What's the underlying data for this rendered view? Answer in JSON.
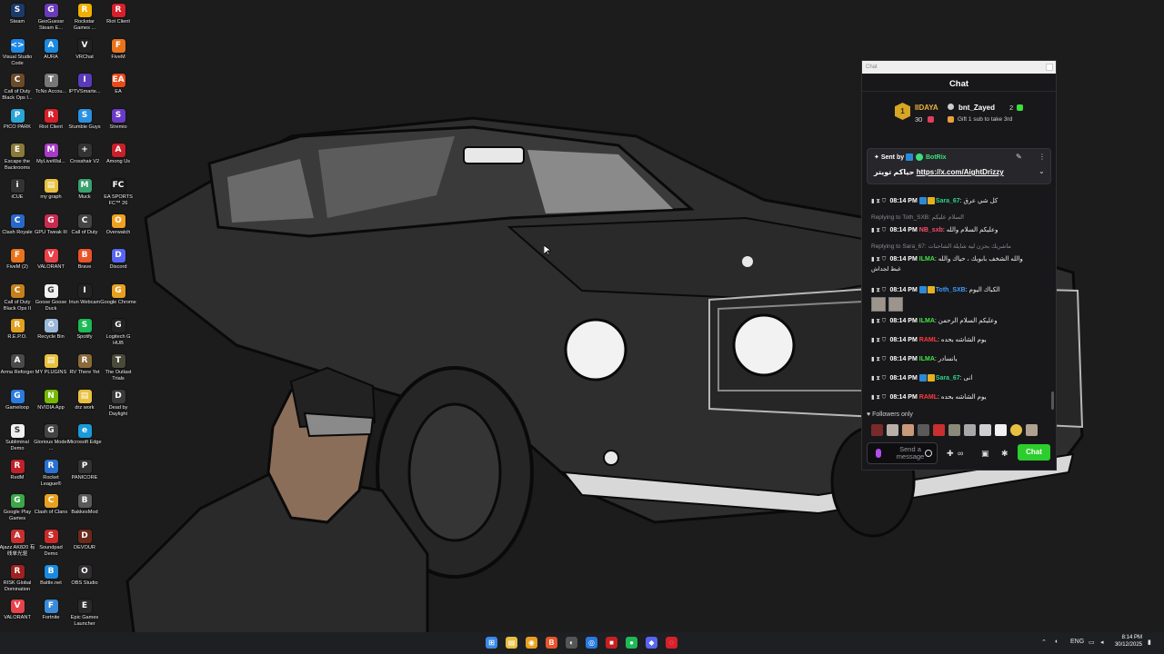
{
  "desktop_icons": [
    {
      "label": "Steam",
      "color": "#1a3a6b",
      "glyph": "S"
    },
    {
      "label": "Visual Studio Code",
      "color": "#1e88e5",
      "glyph": "<>"
    },
    {
      "label": "Call of Duty Black Ops I...",
      "color": "#6b4a2a",
      "glyph": "C"
    },
    {
      "label": "PICO PARK",
      "color": "#2aa5d8",
      "glyph": "P"
    },
    {
      "label": "Escape the Backrooms",
      "color": "#8a7a3a",
      "glyph": "E"
    },
    {
      "label": "iCUE",
      "color": "#333333",
      "glyph": "i"
    },
    {
      "label": "Clash Royale",
      "color": "#2a68c8",
      "glyph": "C"
    },
    {
      "label": "FiveM (2)",
      "color": "#e8731c",
      "glyph": "F"
    },
    {
      "label": "Call of Duty Black Ops II",
      "color": "#c4801a",
      "glyph": "C"
    },
    {
      "label": "R.E.P.O.",
      "color": "#e0a020",
      "glyph": "R"
    },
    {
      "label": "Arma Reforger",
      "color": "#4a4a4a",
      "glyph": "A"
    },
    {
      "label": "Gameloop",
      "color": "#2a7ae0",
      "glyph": "G"
    },
    {
      "label": "Subliminal Demo",
      "color": "#f0f0f0",
      "glyph": "S"
    },
    {
      "label": "RedM",
      "color": "#c0202a",
      "glyph": "R"
    },
    {
      "label": "Google Play Games",
      "color": "#3ca64a",
      "glyph": "G"
    },
    {
      "label": "Ajazz AK820 有线单光驱",
      "color": "#c83030",
      "glyph": "A"
    },
    {
      "label": "RISK Global Domination",
      "color": "#a02020",
      "glyph": "R"
    },
    {
      "label": "VALORANT",
      "color": "#e8424a",
      "glyph": "V"
    },
    {
      "label": "GeoGuessr Steam E...",
      "color": "#6a3ab8",
      "glyph": "G"
    },
    {
      "label": "AURA",
      "color": "#1a8ae0",
      "glyph": "A"
    },
    {
      "label": "TcNo Accou...",
      "color": "#777777",
      "glyph": "T"
    },
    {
      "label": "Riot Client",
      "color": "#d8202a",
      "glyph": "R"
    },
    {
      "label": "MyLiveWal...",
      "color": "#a83ac8",
      "glyph": "M"
    },
    {
      "label": "my graph",
      "color": "#e8c040",
      "glyph": "▤"
    },
    {
      "label": "GPU Tweak III",
      "color": "#c82a50",
      "glyph": "G"
    },
    {
      "label": "VALORANT",
      "color": "#e8424a",
      "glyph": "V"
    },
    {
      "label": "Goose Goose Duck",
      "color": "#f0f0f0",
      "glyph": "G"
    },
    {
      "label": "Recycle Bin",
      "color": "#9ab8d8",
      "glyph": "♻"
    },
    {
      "label": "MY PLUGINS",
      "color": "#e8c040",
      "glyph": "▤"
    },
    {
      "label": "NVIDIA App",
      "color": "#76b900",
      "glyph": "N"
    },
    {
      "label": "Glorious Model ...",
      "color": "#444444",
      "glyph": "G"
    },
    {
      "label": "Rocket League®",
      "color": "#2a70d0",
      "glyph": "R"
    },
    {
      "label": "Clash of Clans",
      "color": "#e8a020",
      "glyph": "C"
    },
    {
      "label": "Soundpad Demo",
      "color": "#c82a2a",
      "glyph": "S"
    },
    {
      "label": "Battle.net",
      "color": "#1a8ae0",
      "glyph": "B"
    },
    {
      "label": "Fortnite",
      "color": "#3a8ad8",
      "glyph": "F"
    },
    {
      "label": "Rockstar Games ...",
      "color": "#f0b000",
      "glyph": "R"
    },
    {
      "label": "VRChat",
      "color": "#222222",
      "glyph": "V"
    },
    {
      "label": "IPTVSmarte...",
      "color": "#5a3ab8",
      "glyph": "I"
    },
    {
      "label": "Stumble Guys",
      "color": "#2a90e0",
      "glyph": "S"
    },
    {
      "label": "Crosshair V2",
      "color": "#333333",
      "glyph": "+"
    },
    {
      "label": "Muck",
      "color": "#3aa070",
      "glyph": "M"
    },
    {
      "label": "Call of Duty",
      "color": "#444444",
      "glyph": "C"
    },
    {
      "label": "Brave",
      "color": "#e8542a",
      "glyph": "B"
    },
    {
      "label": "Iriun Webcam",
      "color": "#222222",
      "glyph": "I"
    },
    {
      "label": "Spotify",
      "color": "#1db954",
      "glyph": "S"
    },
    {
      "label": "RV There Yet",
      "color": "#8a6a3a",
      "glyph": "R"
    },
    {
      "label": "drz work",
      "color": "#e8c040",
      "glyph": "▤"
    },
    {
      "label": "Microsoft Edge",
      "color": "#1a9ad8",
      "glyph": "e"
    },
    {
      "label": "PANICORE",
      "color": "#333333",
      "glyph": "P"
    },
    {
      "label": "BakkesMod",
      "color": "#5a5a5a",
      "glyph": "B"
    },
    {
      "label": "DEVOUR",
      "color": "#6a2a1a",
      "glyph": "D"
    },
    {
      "label": "OBS Studio",
      "color": "#302e31",
      "glyph": "O"
    },
    {
      "label": "Epic Games Launcher",
      "color": "#2a2a2a",
      "glyph": "E"
    },
    {
      "label": "Riot Client",
      "color": "#d8202a",
      "glyph": "R"
    },
    {
      "label": "FiveM",
      "color": "#e8731c",
      "glyph": "F"
    },
    {
      "label": "EA",
      "color": "#e84a1a",
      "glyph": "EA"
    },
    {
      "label": "Stremio",
      "color": "#6a3ac8",
      "glyph": "S"
    },
    {
      "label": "Among Us",
      "color": "#c8202a",
      "glyph": "A"
    },
    {
      "label": "EA SPORTS FC™ 26",
      "color": "#1a1a1a",
      "glyph": "FC"
    },
    {
      "label": "Overwatch",
      "color": "#f0a020",
      "glyph": "O"
    },
    {
      "label": "Discord",
      "color": "#5865f2",
      "glyph": "D"
    },
    {
      "label": "Google Chrome",
      "color": "#e8a020",
      "glyph": "G"
    },
    {
      "label": "Logitech G HUB",
      "color": "#222222",
      "glyph": "G"
    },
    {
      "label": "The Outlast Trials",
      "color": "#4a4a3a",
      "glyph": "T"
    },
    {
      "label": "Dead by Daylight",
      "color": "#3a3a3a",
      "glyph": "D"
    }
  ],
  "chat": {
    "window_title": "Chat",
    "header_title": "Chat",
    "leaderboard": {
      "rank": "1",
      "first_name": "IIDAYA",
      "first_count": "30",
      "second_name": "bnt_Zayed",
      "second_count": "2",
      "gift_text": "Gift 1 sub to take 3rd"
    },
    "pinned": {
      "sent_by_label": "Sent by",
      "sender": "BotRix",
      "text_prefix": "حياكم تويتر",
      "link": "https://x.com/AightDrizzy",
      "menu_icon": "⋮",
      "pin_icon": "📌",
      "expand_icon": "⌄"
    },
    "messages": [
      {
        "time": "08:14 PM",
        "user": "Sara_67",
        "user_color": "#2bd48a",
        "text": "كل شي عرق"
      },
      {
        "reply": "Replying to Toth_SXB: السلام عليكم"
      },
      {
        "time": "08:14 PM",
        "user": "NB_sxb",
        "user_color": "#ff4d6d",
        "text": "وعليكم السلام والله"
      },
      {
        "reply": "Replying to Sara_67: ماشربك بحزن ليه شايلة الشاحنات"
      },
      {
        "time": "08:14 PM",
        "user": "ILMA",
        "user_color": "#42e642",
        "text": "والله الشخف بابوبك ، حياك والله",
        "text2": "غبط لجداش"
      },
      {
        "time": "08:14 PM",
        "user": "Toth_SXB",
        "user_color": "#3a9cff",
        "text": "الكباك اليوم"
      },
      {
        "time": "08:14 PM",
        "user": "ILMA",
        "user_color": "#42e642",
        "text": "وعليكم السلام الرحمن"
      },
      {
        "time": "08:14 PM",
        "user": "RAML",
        "user_color": "#ff3b3b",
        "text": "يوم الشاشه بحده"
      },
      {
        "time": "08:14 PM",
        "user": "ILMA",
        "user_color": "#42e642",
        "text": "يانسادر"
      },
      {
        "time": "08:14 PM",
        "user": "Sara_67",
        "user_color": "#2bd48a",
        "text": "انى"
      },
      {
        "time": "08:14 PM",
        "user": "RAML",
        "user_color": "#ff3b3b",
        "text": "يوم الشاشه بحده"
      }
    ],
    "followers_only": "Followers only",
    "input_placeholder": "Send a message",
    "send_label": "Chat"
  },
  "taskbar": {
    "apps": [
      {
        "name": "start-button",
        "glyph": "⊞",
        "color": "#3a8ae8"
      },
      {
        "name": "file-explorer",
        "glyph": "▤",
        "color": "#e8c040"
      },
      {
        "name": "chrome",
        "glyph": "◉",
        "color": "#e8a020"
      },
      {
        "name": "brave",
        "glyph": "B",
        "color": "#e8542a"
      },
      {
        "name": "app-1",
        "glyph": "◐",
        "color": "#555555"
      },
      {
        "name": "app-2",
        "glyph": "◎",
        "color": "#2a7ae0"
      },
      {
        "name": "app-3",
        "glyph": "■",
        "color": "#c82020"
      },
      {
        "name": "spotify",
        "glyph": "●",
        "color": "#1db954"
      },
      {
        "name": "discord",
        "glyph": "◆",
        "color": "#5865f2"
      },
      {
        "name": "app-4",
        "glyph": "◌",
        "color": "#d8202a"
      }
    ],
    "language": "ENG",
    "time": "8:14 PM",
    "date": "30/12/2025"
  }
}
